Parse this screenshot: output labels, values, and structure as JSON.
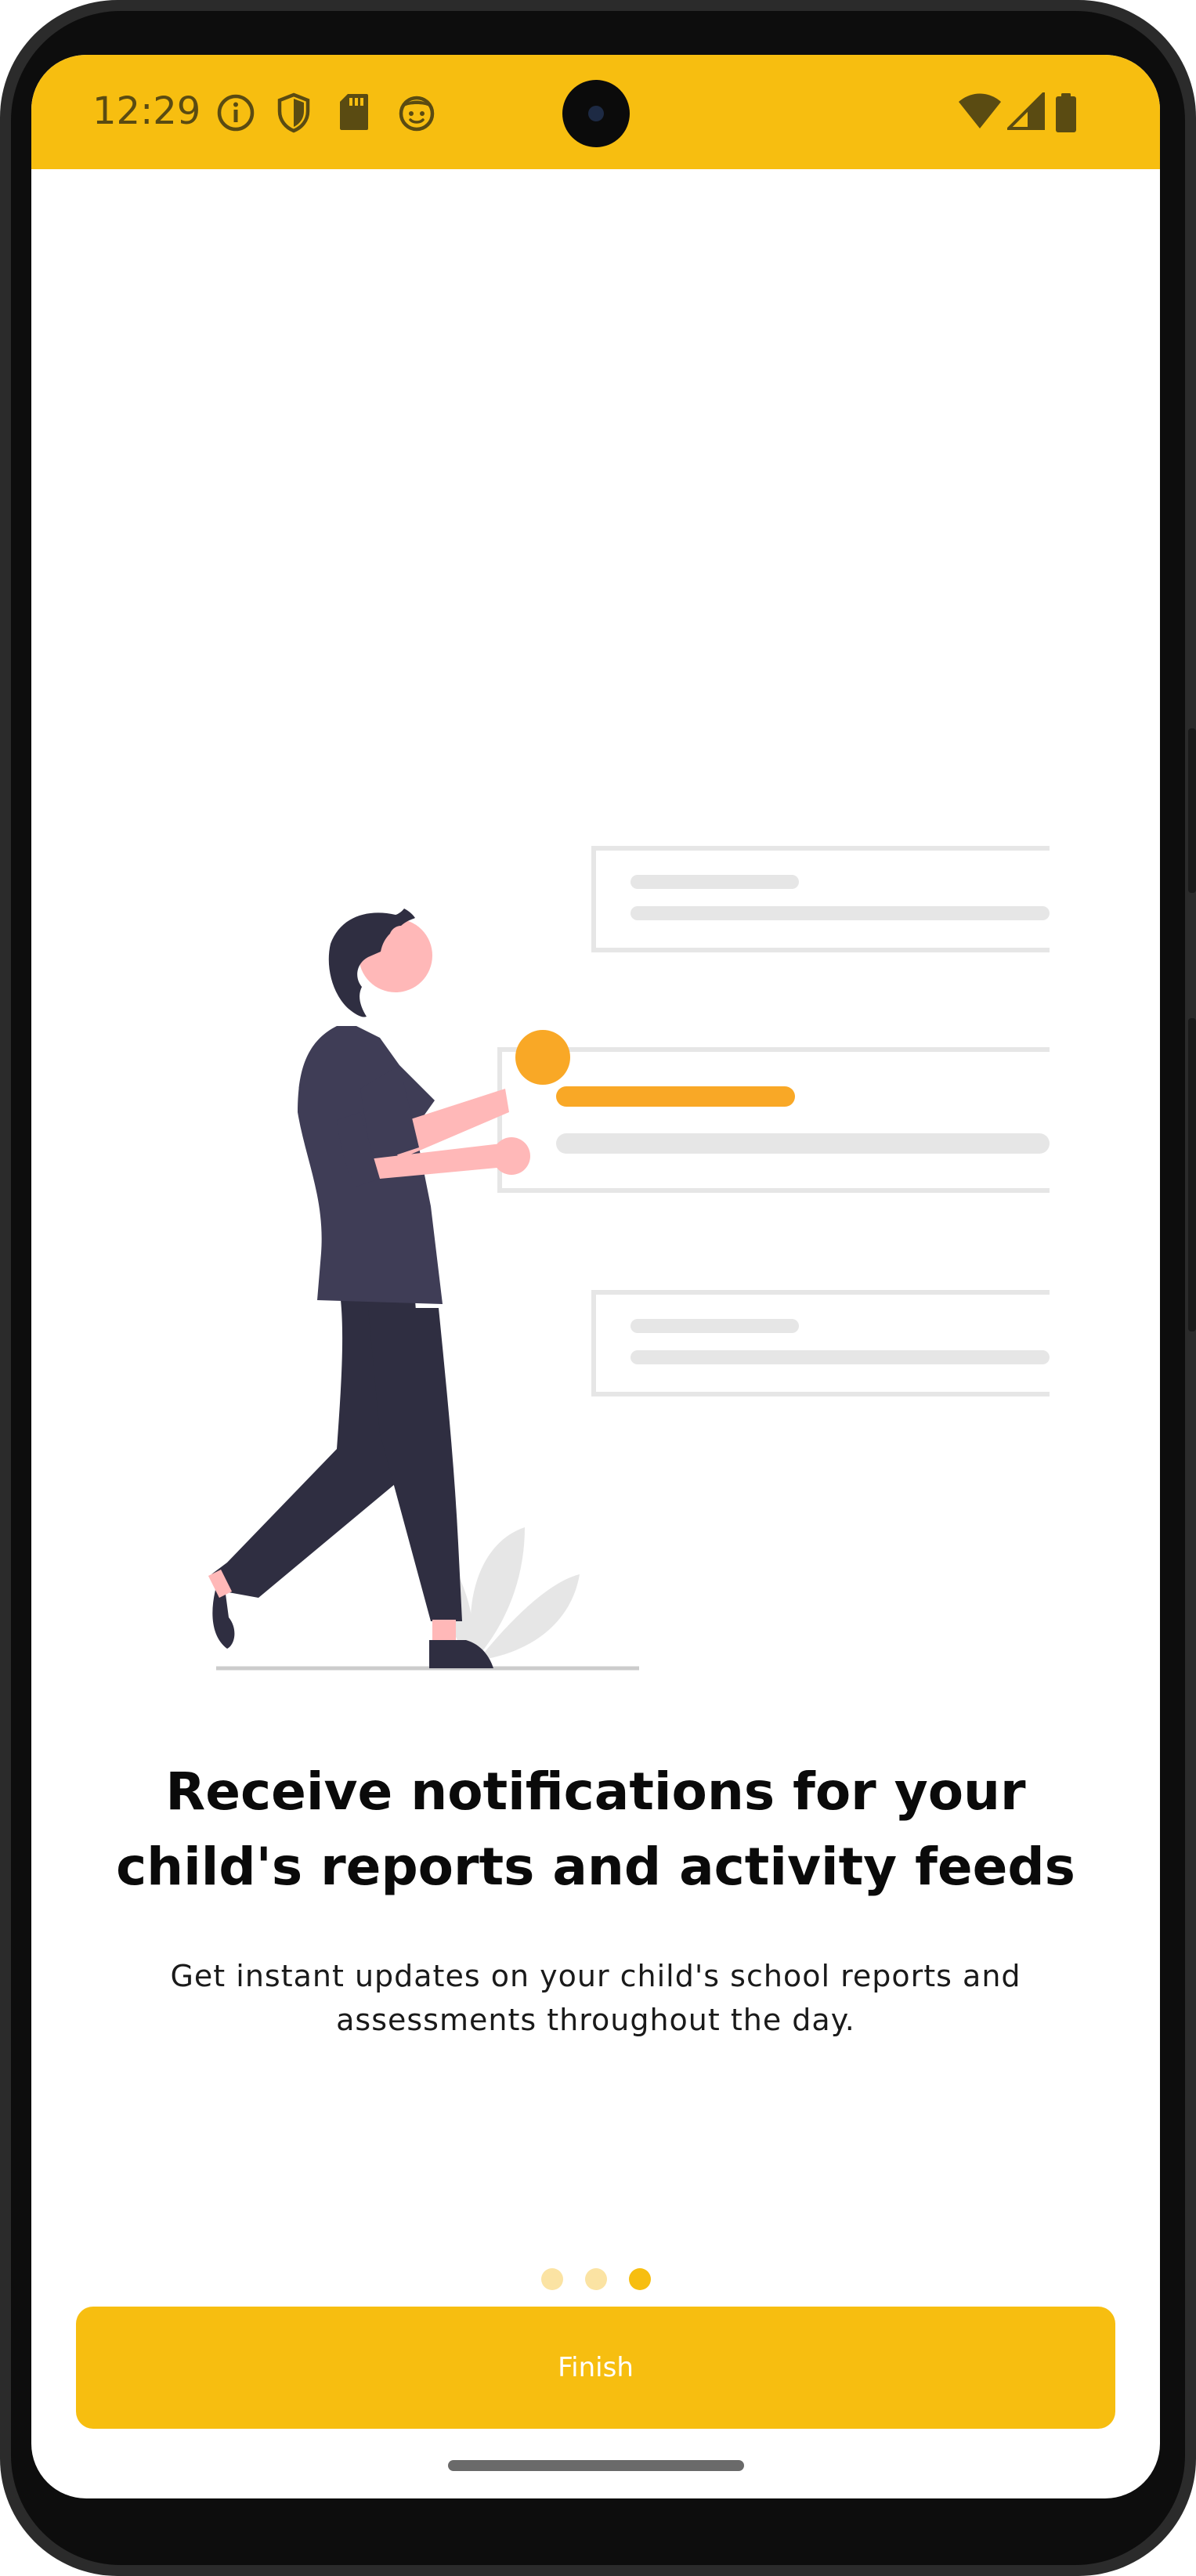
{
  "status_bar": {
    "time": "12:29",
    "icons": [
      "info-icon",
      "shield-icon",
      "sd-card-icon",
      "face-icon"
    ],
    "right_icons": [
      "wifi-icon",
      "signal-icon",
      "battery-icon"
    ],
    "background": "#f7be10"
  },
  "onboarding": {
    "title": "Receive notifications for your child's reports and activity feeds",
    "description": "Get instant updates on your child's school reports and assessments throughout the day.",
    "page_count": 3,
    "active_page": 3,
    "finish_label": "Finish"
  },
  "colors": {
    "accent": "#f7be10",
    "illustration_accent": "#f9a826",
    "dot_inactive": "#fbe3a3",
    "text_dark": "#0a0a0a"
  }
}
